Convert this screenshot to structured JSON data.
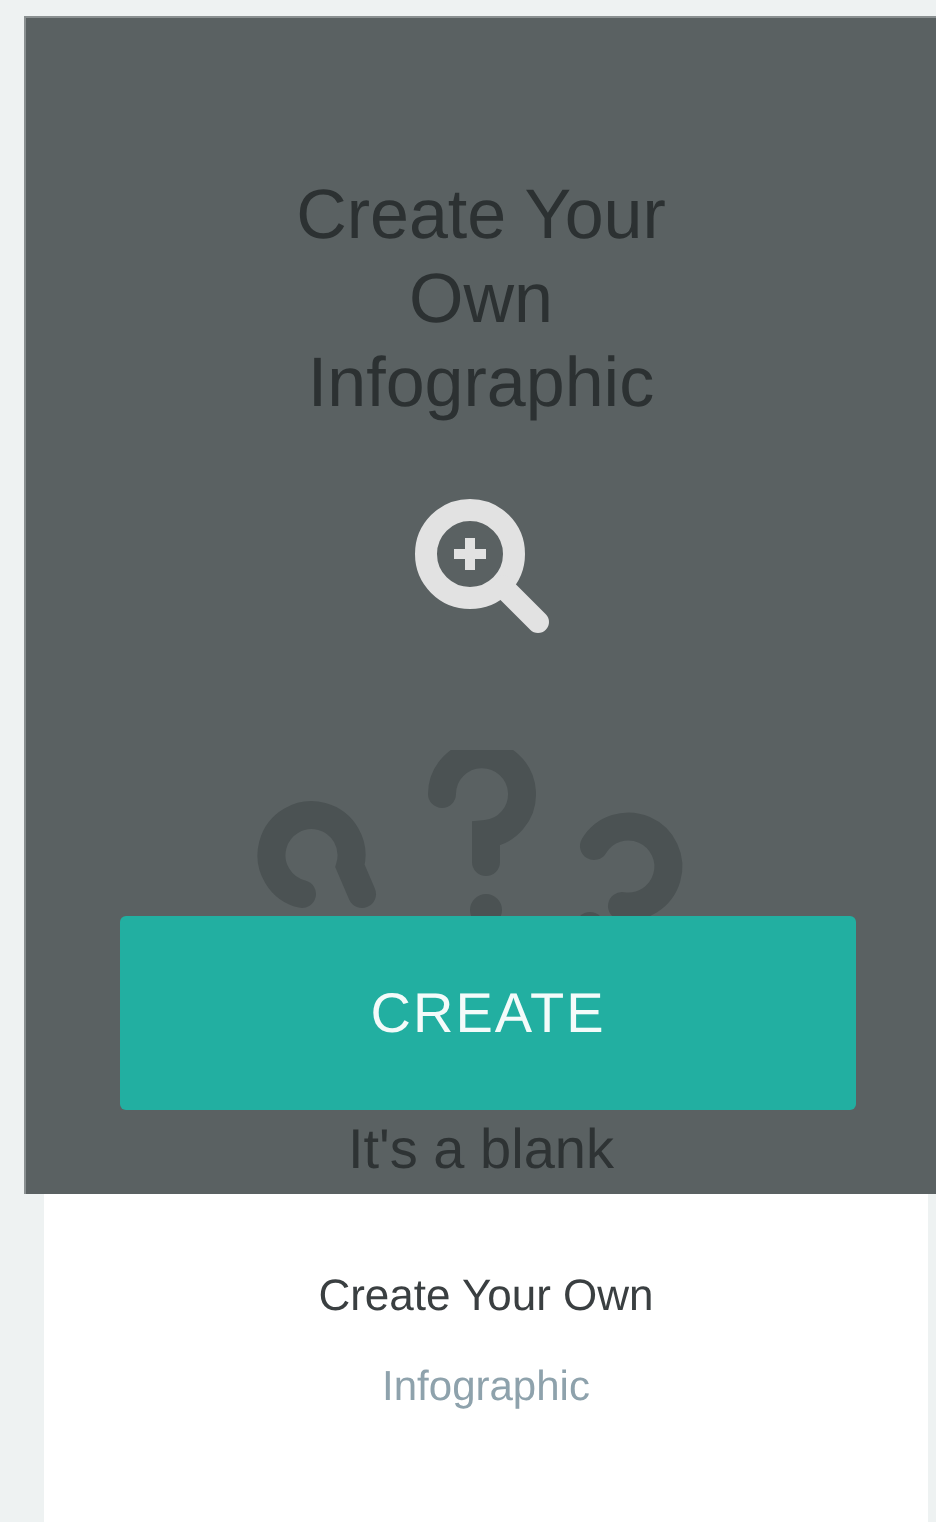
{
  "preview": {
    "title": "Create Your Own Infographic",
    "blank_text": "It's a blank"
  },
  "create_button": {
    "label": "CREATE"
  },
  "card": {
    "title": "Create Your Own",
    "subtitle": "Infographic"
  }
}
